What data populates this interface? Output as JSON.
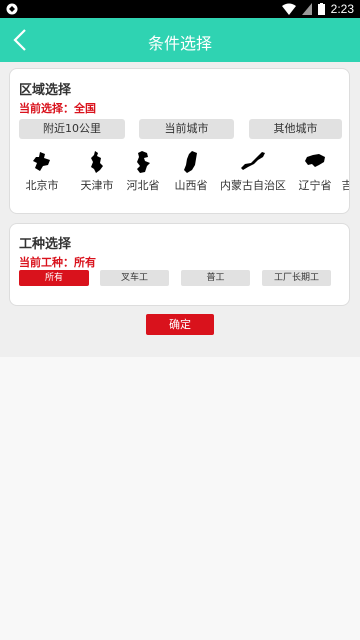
{
  "status_bar": {
    "time": "2:23",
    "icons": [
      "wifi-icon",
      "signal-icon",
      "battery-icon"
    ]
  },
  "app_bar": {
    "title": "条件选择",
    "back_icon": "chevron-left-icon"
  },
  "region_section": {
    "title": "区域选择",
    "current_label": "当前选择：全国",
    "segments": [
      "附近10公里",
      "当前城市",
      "其他城市"
    ],
    "regions": [
      "北京市",
      "天津市",
      "河北省",
      "山西省",
      "内蒙古自治区",
      "辽宁省",
      "吉"
    ]
  },
  "work_section": {
    "title": "工种选择",
    "current_label": "当前工种：所有",
    "types": [
      "所有",
      "叉车工",
      "普工",
      "工厂长期工"
    ],
    "active_type": "所有"
  },
  "confirm_label": "确定",
  "colors": {
    "accent": "#2fd3b2",
    "primary_red": "#d9121c"
  }
}
